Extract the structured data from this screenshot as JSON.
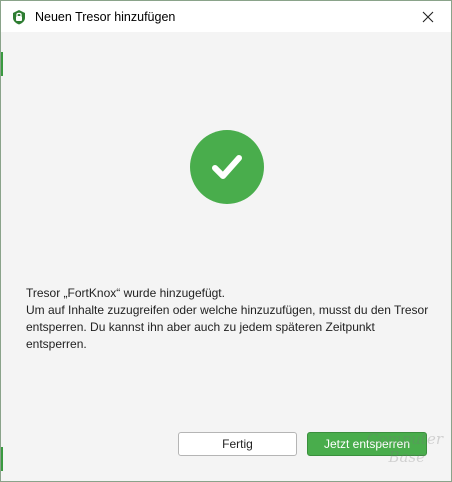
{
  "window": {
    "title": "Neuen Tresor hinzufügen",
    "app_icon": "cryptomator-vault-icon",
    "close_icon": "close-icon"
  },
  "success": {
    "icon": "checkmark-icon",
    "color": "#49ad4c"
  },
  "message": {
    "line1": "Tresor „FortKnox“ wurde hinzugefügt.",
    "line2": "Um auf Inhalte zuzugreifen oder welche hinzuzufügen, musst du den Tresor entsperren. Du kannst ihn aber auch zu jedem späteren Zeitpunkt entsperren."
  },
  "buttons": {
    "done_label": "Fertig",
    "unlock_label": "Jetzt entsperren"
  },
  "colors": {
    "accent": "#49ad4c",
    "content_bg": "#f4f4f4"
  }
}
